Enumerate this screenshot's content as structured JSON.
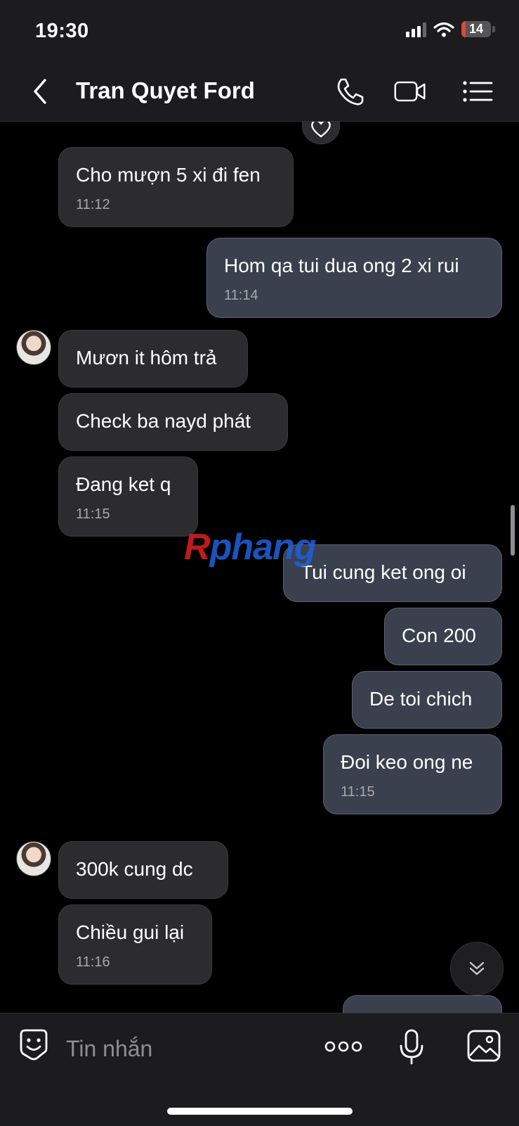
{
  "status_bar": {
    "time": "19:30",
    "battery_level": "14"
  },
  "header": {
    "contact_name": "Tran Quyet Ford"
  },
  "messages": [
    {
      "text": "Cho mượn 5 xi đi fen",
      "time": "11:12"
    },
    {
      "text": "Hom qa tui dua ong 2 xi rui",
      "time": "11:14"
    },
    {
      "text": "Mươn it hôm trả"
    },
    {
      "text": "Check ba nayd phát"
    },
    {
      "text": "Đang ket q",
      "time": "11:15"
    },
    {
      "text": "Tui cung ket ong oi"
    },
    {
      "text": "Con 200"
    },
    {
      "text": "De toi chich"
    },
    {
      "text": "Đoi keo ong ne",
      "time": "11:15"
    },
    {
      "text": "300k cung dc"
    },
    {
      "text": "Chiều gui lại",
      "time": "11:16"
    }
  ],
  "watermark": {
    "first": "R",
    "rest": "phang"
  },
  "composer": {
    "placeholder": "Tin nhắn"
  },
  "colors": {
    "background": "#000000",
    "bar": "#1c1c1e",
    "incoming_bubble": "#2c2c2e",
    "outgoing_bubble": "#3a404d",
    "battery_low": "#e5453b"
  },
  "icons": {
    "back": "chevron-left-icon",
    "call": "phone-icon",
    "video": "video-camera-icon",
    "menu": "list-menu-icon",
    "reaction": "heart-icon",
    "emoji": "sticker-icon",
    "more": "more-dots-icon",
    "mic": "microphone-icon",
    "image": "image-icon",
    "scroll_down": "double-chevron-down-icon"
  }
}
